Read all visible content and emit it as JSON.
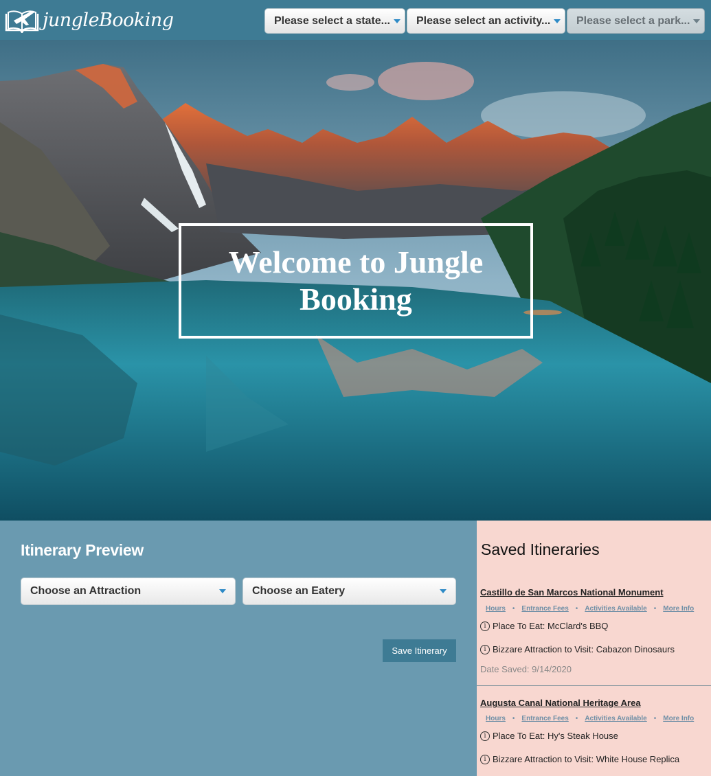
{
  "brand": {
    "name": "jungleBooking"
  },
  "nav": {
    "state_select": "Please select a state...",
    "activity_select": "Please select an activity...",
    "park_select": "Please select a park..."
  },
  "hero": {
    "welcome": "Welcome to Jungle Booking"
  },
  "itinerary": {
    "title": "Itinerary Preview",
    "attraction_select": "Choose an Attraction",
    "eatery_select": "Choose an Eatery",
    "save_button": "Save Itinerary"
  },
  "saved": {
    "title": "Saved Itineraries",
    "items": [
      {
        "park": "Castillo de San Marcos National Monument",
        "links": [
          "Hours",
          "Entrance Fees",
          "Activities Available",
          "More Info"
        ],
        "eat": "Place To Eat: McClard's BBQ",
        "attraction": "Bizzare Attraction to Visit: Cabazon Dinosaurs",
        "date": "Date Saved: 9/14/2020"
      },
      {
        "park": "Augusta Canal National Heritage Area",
        "links": [
          "Hours",
          "Entrance Fees",
          "Activities Available",
          "More Info"
        ],
        "eat": "Place To Eat: Hy's Steak House",
        "attraction": "Bizzare Attraction to Visit: White House Replica"
      }
    ]
  },
  "colors": {
    "nav_bg": "#3e7b94",
    "itinerary_bg": "#6a9ab0",
    "saved_bg": "#f8d7d0",
    "accent_caret": "#2d8ac6"
  }
}
